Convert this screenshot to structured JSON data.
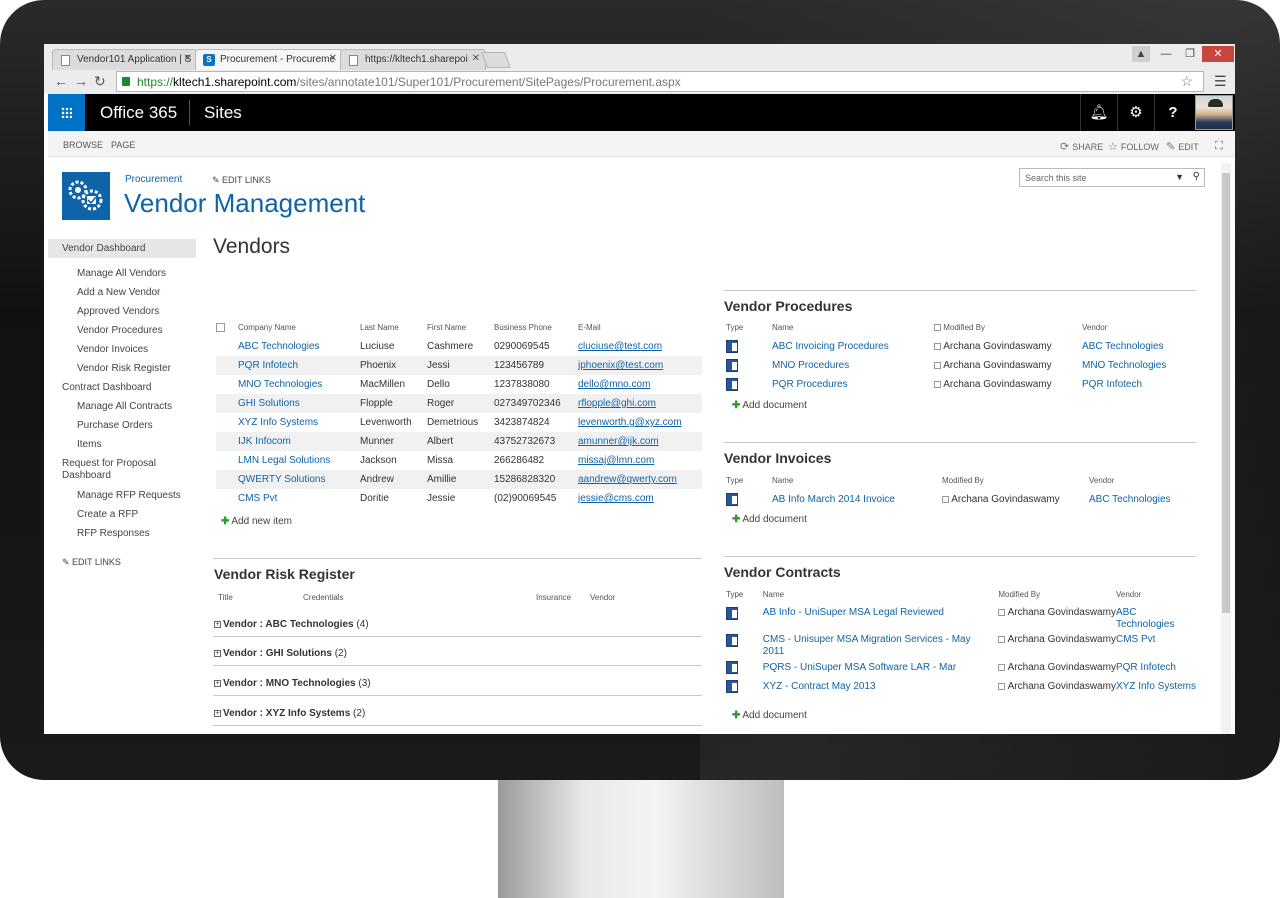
{
  "browser": {
    "tabs": [
      {
        "title": "Vendor101 Application | S",
        "active": false,
        "icon": "page-icon"
      },
      {
        "title": "Procurement - Procureme",
        "active": true,
        "icon": "sharepoint-icon"
      },
      {
        "title": "https://kltech1.sharepoi",
        "active": false,
        "icon": "page-icon"
      }
    ],
    "url_scheme": "https://",
    "url_host": "kltech1.sharepoint.com",
    "url_path": "/sites/annotate101/Super101/Procurement/SitePages/Procurement.aspx"
  },
  "suitebar": {
    "brand": "Office 365",
    "app": "Sites",
    "colors": {
      "waffle": "#0072c6",
      "bar": "#000000"
    }
  },
  "ribbon": {
    "tabs": [
      "BROWSE",
      "PAGE"
    ],
    "actions": [
      "SHARE",
      "FOLLOW",
      "EDIT"
    ]
  },
  "site": {
    "crumb": "Procurement",
    "edit_links": "EDIT LINKS",
    "title": "Vendor Management",
    "search_placeholder": "Search this site",
    "accent": "#0f63a8"
  },
  "leftnav": {
    "items": [
      {
        "label": "Vendor Dashboard",
        "level": "selected"
      },
      {
        "label": "Manage All Vendors",
        "level": "sub"
      },
      {
        "label": "Add a New Vendor",
        "level": "sub"
      },
      {
        "label": "Approved Vendors",
        "level": "sub"
      },
      {
        "label": "Vendor Procedures",
        "level": "sub"
      },
      {
        "label": "Vendor Invoices",
        "level": "sub"
      },
      {
        "label": "Vendor Risk Register",
        "level": "sub"
      },
      {
        "label": "Contract Dashboard",
        "level": "top"
      },
      {
        "label": "Manage All Contracts",
        "level": "sub"
      },
      {
        "label": "Purchase Orders",
        "level": "sub"
      },
      {
        "label": "Items",
        "level": "sub"
      },
      {
        "label": "Request for Proposal Dashboard",
        "level": "multi"
      },
      {
        "label": "Manage RFP Requests",
        "level": "sub"
      },
      {
        "label": "Create a RFP",
        "level": "sub"
      },
      {
        "label": "RFP Responses",
        "level": "sub"
      }
    ],
    "edit_links": "EDIT LINKS"
  },
  "vendors": {
    "title": "Vendors",
    "columns": [
      "Company Name",
      "Last Name",
      "First Name",
      "Business Phone",
      "E-Mail"
    ],
    "rows": [
      [
        "ABC Technologies",
        "Luciuse",
        "Cashmere",
        "0290069545",
        "cluciuse@test.com"
      ],
      [
        "PQR Infotech",
        "Phoenix",
        "Jessi",
        "123456789",
        "jphoenix@test.com"
      ],
      [
        "MNO Technologies",
        "MacMillen",
        "Dello",
        "1237838080",
        "dello@mno.com"
      ],
      [
        "GHI Solutions",
        "Flopple",
        "Roger",
        "027349702346",
        "rflopple@ghi.com"
      ],
      [
        "XYZ Info Systems",
        "Levenworth",
        "Demetrious",
        "3423874824",
        "levenworth.g@xyz.com"
      ],
      [
        "IJK Infocom",
        "Munner",
        "Albert",
        "43752732673",
        "amunner@ijk.com"
      ],
      [
        "LMN Legal Solutions",
        "Jackson",
        "Missa",
        "266286482",
        "missaj@lmn.com"
      ],
      [
        "QWERTY Solutions",
        "Andrew",
        "Amillie",
        "15286828320",
        "aandrew@qwerty.com"
      ],
      [
        "CMS Pvt",
        "Doritie",
        "Jessie",
        "(02)90069545",
        "jessie@cms.com"
      ]
    ],
    "add_label": "Add new item"
  },
  "risk_register": {
    "title": "Vendor Risk Register",
    "columns": [
      "Title",
      "Credentials",
      "Insurance",
      "Vendor"
    ],
    "groups": [
      {
        "label": "Vendor : ABC Technologies",
        "count": "(4)"
      },
      {
        "label": "Vendor : GHI Solutions",
        "count": "(2)"
      },
      {
        "label": "Vendor : MNO Technologies",
        "count": "(3)"
      },
      {
        "label": "Vendor : XYZ Info Systems",
        "count": "(2)"
      }
    ]
  },
  "procedures": {
    "title": "Vendor Procedures",
    "columns": [
      "Type",
      "Name",
      "Modified By",
      "Vendor"
    ],
    "rows": [
      [
        "ABC Invoicing Procedures",
        "Archana Govindaswamy",
        "ABC Technologies"
      ],
      [
        "MNO Procedures",
        "Archana Govindaswamy",
        "MNO Technologies"
      ],
      [
        "PQR Procedures",
        "Archana Govindaswamy",
        "PQR Infotech"
      ]
    ],
    "add_label": "Add document"
  },
  "invoices": {
    "title": "Vendor Invoices",
    "columns": [
      "Type",
      "Name",
      "Modified By",
      "Vendor"
    ],
    "rows": [
      [
        "AB Info March 2014 Invoice",
        "Archana Govindaswamy",
        "ABC Technologies"
      ]
    ],
    "add_label": "Add document"
  },
  "contracts": {
    "title": "Vendor Contracts",
    "columns": [
      "Type",
      "Name",
      "Modified By",
      "Vendor"
    ],
    "rows": [
      [
        "AB Info - UniSuper MSA Legal Reviewed",
        "Archana Govindaswamy",
        "ABC Technologies"
      ],
      [
        "CMS - Unisuper MSA Migration Services - May 2011",
        "Archana Govindaswamy",
        "CMS Pvt"
      ],
      [
        "PQRS - UniSuper MSA Software LAR - Mar",
        "Archana Govindaswamy",
        "PQR Infotech"
      ],
      [
        "XYZ - Contract May 2013",
        "Archana Govindaswamy",
        "XYZ Info Systems"
      ]
    ],
    "add_label": "Add document"
  }
}
